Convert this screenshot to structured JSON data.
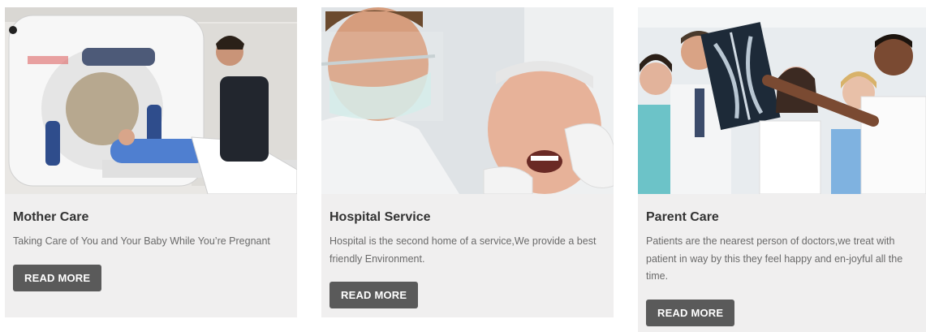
{
  "cards": [
    {
      "title": "Mother Care",
      "description": "Taking Care of You and Your Baby While You’re Pregnant",
      "button_label": "READ MORE"
    },
    {
      "title": "Hospital Service",
      "description": "Hospital is the second home of a service,We provide a best friendly Environment.",
      "button_label": "READ MORE"
    },
    {
      "title": "Parent Care",
      "description": "Patients are the nearest person of doctors,we treat with patient in way by this they feel happy and en-joyful all the time.",
      "button_label": "READ MORE"
    }
  ],
  "colors": {
    "card_background": "#f0efef",
    "button_background": "#5a5a5a",
    "button_text": "#ffffff",
    "title_text": "#333333",
    "body_text": "#6a6a6a"
  }
}
